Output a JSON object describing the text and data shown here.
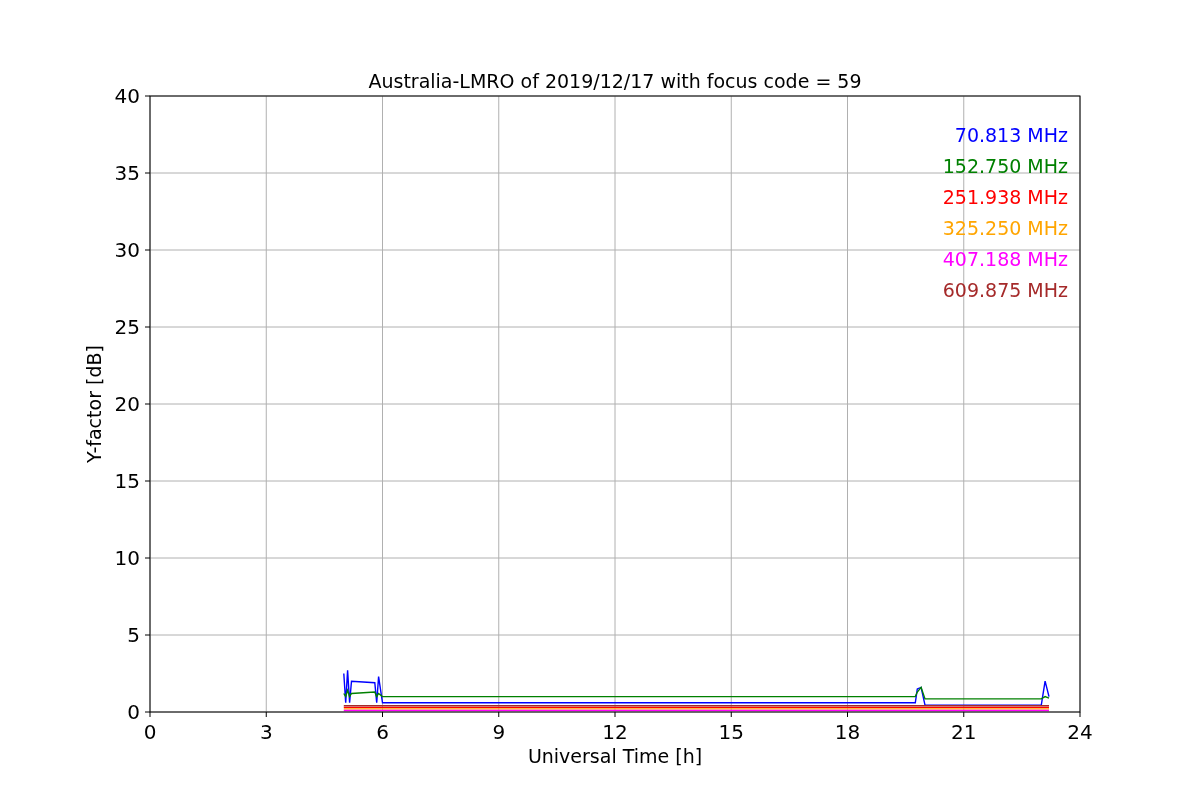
{
  "chart_data": {
    "type": "line",
    "title": "Australia-LMRO of 2019/12/17 with focus code = 59",
    "xlabel": "Universal Time [h]",
    "ylabel": "Y-factor [dB]",
    "x": [
      5.0,
      5.05,
      5.1,
      5.15,
      5.2,
      5.8,
      5.85,
      5.9,
      6.0,
      19.75,
      19.8,
      19.9,
      20.0,
      23.0,
      23.1,
      23.2
    ],
    "series": [
      {
        "name": "70.813 MHz",
        "color": "#0000ff",
        "values": [
          2.5,
          0.6,
          2.7,
          0.6,
          2.0,
          1.9,
          0.6,
          2.3,
          0.6,
          0.6,
          1.5,
          1.6,
          0.45,
          0.45,
          2.0,
          1.0
        ]
      },
      {
        "name": "152.750 MHz",
        "color": "#008000",
        "values": [
          1.2,
          1.0,
          1.4,
          1.0,
          1.2,
          1.3,
          1.0,
          1.2,
          1.0,
          1.0,
          1.3,
          1.6,
          0.85,
          0.85,
          1.0,
          0.9
        ]
      },
      {
        "name": "251.938 MHz",
        "color": "#ff0000",
        "values": [
          0.3,
          0.3,
          0.3,
          0.3,
          0.3,
          0.3,
          0.3,
          0.3,
          0.3,
          0.3,
          0.3,
          0.3,
          0.3,
          0.3,
          0.3,
          0.3
        ]
      },
      {
        "name": "325.250 MHz",
        "color": "#ffa500",
        "values": [
          0.2,
          0.2,
          0.2,
          0.2,
          0.2,
          0.2,
          0.2,
          0.2,
          0.2,
          0.2,
          0.2,
          0.2,
          0.2,
          0.2,
          0.2,
          0.2
        ]
      },
      {
        "name": "407.188 MHz",
        "color": "#ff00ff",
        "values": [
          0.1,
          0.1,
          0.1,
          0.1,
          0.1,
          0.1,
          0.1,
          0.1,
          0.1,
          0.1,
          0.1,
          0.1,
          0.1,
          0.1,
          0.1,
          0.1
        ]
      },
      {
        "name": "609.875 MHz",
        "color": "#a52a2a",
        "values": [
          0.4,
          0.4,
          0.4,
          0.4,
          0.4,
          0.4,
          0.4,
          0.4,
          0.4,
          0.4,
          0.4,
          0.4,
          0.4,
          0.4,
          0.4,
          0.4
        ]
      }
    ],
    "xlim": [
      0,
      24
    ],
    "ylim": [
      0,
      40
    ],
    "xticks": [
      0,
      3,
      6,
      9,
      12,
      15,
      18,
      21,
      24
    ],
    "yticks": [
      0,
      5,
      10,
      15,
      20,
      25,
      30,
      35,
      40
    ],
    "grid": true
  }
}
